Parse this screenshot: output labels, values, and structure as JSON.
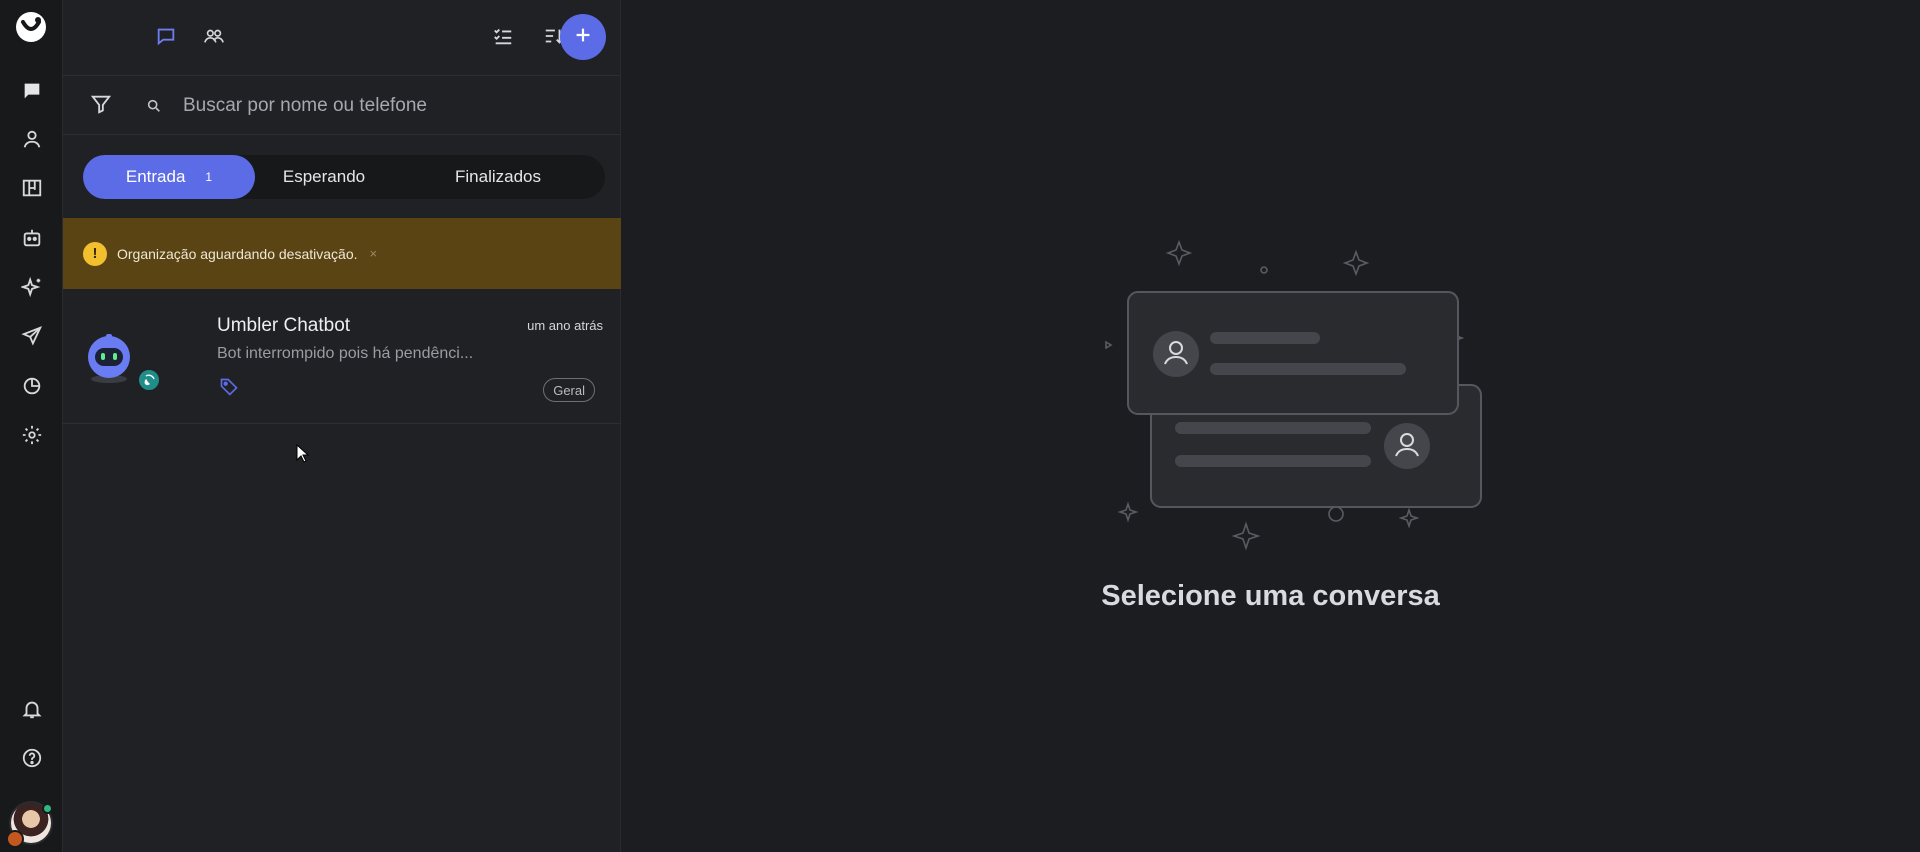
{
  "search": {
    "placeholder": "Buscar por nome ou telefone"
  },
  "tabs": [
    {
      "label": "Entrada",
      "count": "1"
    },
    {
      "label": "Esperando"
    },
    {
      "label": "Finalizados"
    }
  ],
  "warning": {
    "text": "Organização aguardando desativação.",
    "close": "×",
    "icon": "!"
  },
  "conversation": {
    "name": "Umbler Chatbot",
    "time": "um ano atrás",
    "preview": "Bot interrompido pois há pendênci...",
    "label": "Geral"
  },
  "empty_state": {
    "title": "Selecione uma conversa"
  },
  "colors": {
    "accent": "#5c6be6",
    "warning_bg": "#5b4414",
    "warning_icon": "#f2bf2e",
    "online": "#2fb77f"
  },
  "icons": {
    "rail": [
      "chat-icon",
      "contact-icon",
      "kanban-icon",
      "bot-icon",
      "sparkles-icon",
      "send-icon",
      "reports-icon",
      "settings-icon",
      "bell-icon",
      "help-icon"
    ],
    "toolbar": [
      "conversations-icon",
      "groups-icon",
      "checklist-icon",
      "sort-icon",
      "chevron-down-icon",
      "plus-icon"
    ]
  }
}
